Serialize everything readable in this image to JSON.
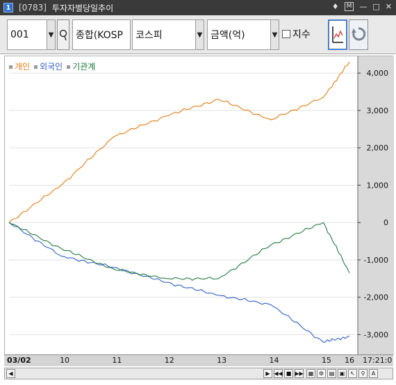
{
  "titlebar": {
    "num": "1",
    "code": "[0783]",
    "name": "투자자별당일추이"
  },
  "toolbar": {
    "code_value": "001",
    "market_label": "종합(KOSP",
    "market_select": "코스피",
    "unit_select": "금액(억)",
    "index_label": "지수"
  },
  "legend": [
    {
      "name": "개인",
      "color": "#e07b14"
    },
    {
      "name": "외국인",
      "color": "#2b5fc8"
    },
    {
      "name": "기관계",
      "color": "#1f7a3c"
    }
  ],
  "chart_data": {
    "type": "line",
    "x": [
      "09:00",
      "10:00",
      "11:00",
      "12:00",
      "13:00",
      "14:00",
      "15:00",
      "15:30"
    ],
    "xlabels": [
      "03/02",
      "10",
      "11",
      "12",
      "13",
      "14",
      "15",
      "16"
    ],
    "current_time": "17:21:0",
    "yticks": [
      4000,
      3000,
      2000,
      1000,
      0,
      -1000,
      -2000,
      -3000
    ],
    "ytick_labels": [
      "4,000",
      "3,000",
      "2,000",
      "1,000",
      "0",
      "-1,000",
      "-2,000",
      "-3,000"
    ],
    "ylim": [
      -3550,
      4450
    ],
    "series": [
      {
        "name": "개인",
        "color": "#e07b14",
        "values": [
          0,
          1000,
          2300,
          2850,
          3300,
          2750,
          3350,
          4300
        ]
      },
      {
        "name": "외국인",
        "color": "#2b5fc8",
        "values": [
          0,
          -900,
          -1200,
          -1600,
          -1950,
          -2200,
          -3200,
          -3050
        ]
      },
      {
        "name": "기관계",
        "color": "#1f7a3c",
        "values": [
          0,
          -700,
          -1250,
          -1500,
          -1500,
          -600,
          0,
          -1350
        ]
      }
    ]
  }
}
